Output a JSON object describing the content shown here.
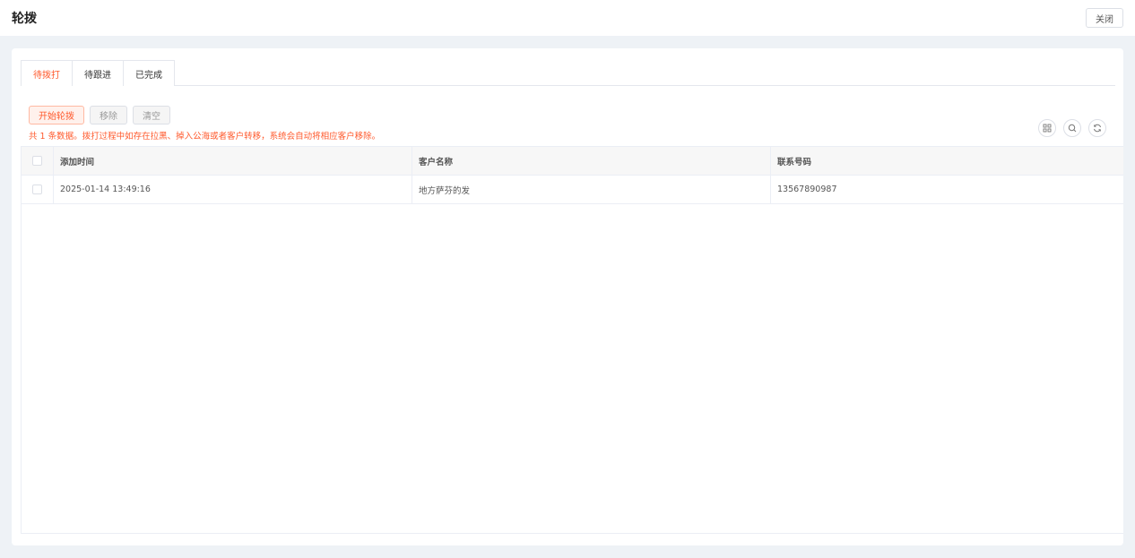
{
  "header": {
    "title": "轮拨",
    "close_label": "关闭"
  },
  "tabs": [
    {
      "label": "待拨打",
      "active": true
    },
    {
      "label": "待跟进",
      "active": false
    },
    {
      "label": "已完成",
      "active": false
    }
  ],
  "toolbar": {
    "start_label": "开始轮拨",
    "remove_label": "移除",
    "clear_label": "清空"
  },
  "notice": "共 1 条数据。拨打过程中如存在拉黑、掉入公海或者客户转移，系统会自动将相应客户移除。",
  "icons": [
    "grid-icon",
    "search-icon",
    "refresh-icon"
  ],
  "table": {
    "columns": [
      "添加时间",
      "客户名称",
      "联系号码"
    ],
    "rows": [
      {
        "time": "2025-01-14 13:49:16",
        "name": "地方萨芬的发",
        "phone": "13567890987"
      }
    ]
  },
  "colors": {
    "accent": "#ff5a2d"
  }
}
